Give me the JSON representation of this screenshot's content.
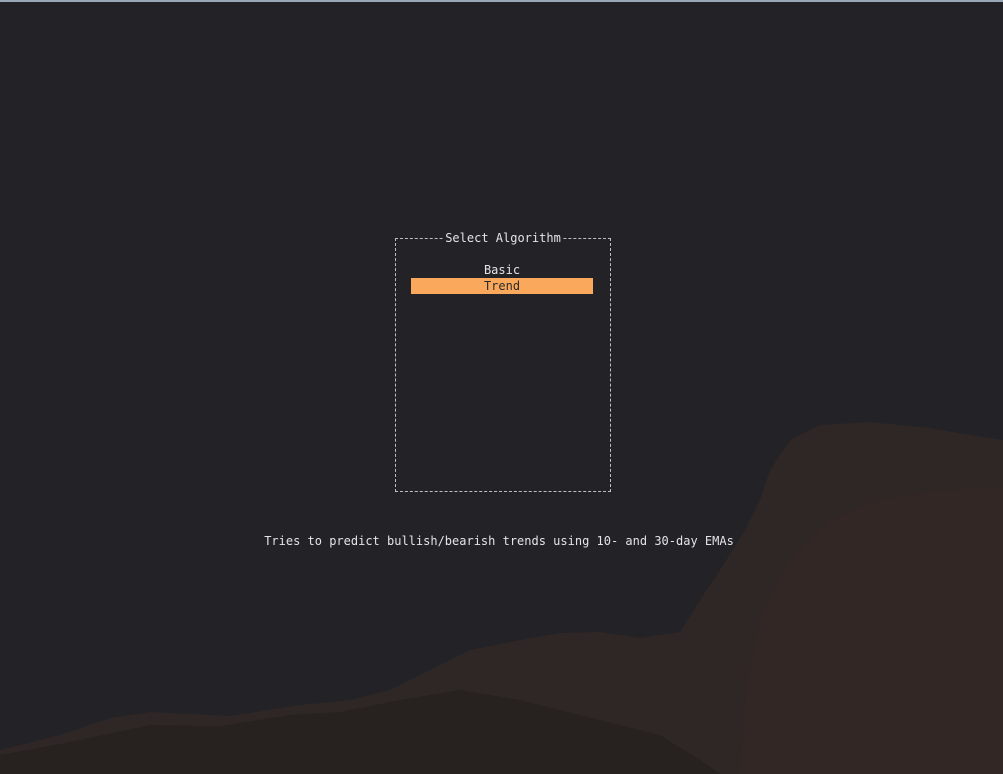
{
  "dialog": {
    "title": "Select Algorithm",
    "items": [
      {
        "label": "Basic",
        "selected": false
      },
      {
        "label": "Trend",
        "selected": true
      }
    ]
  },
  "description": "Tries to predict bullish/bearish trends using 10- and 30-day EMAs",
  "colors": {
    "background": "#232226",
    "highlight": "#f9a85c",
    "mountain": "#3a2a24"
  },
  "icons": {
    "background": "mountain-wallpaper"
  }
}
